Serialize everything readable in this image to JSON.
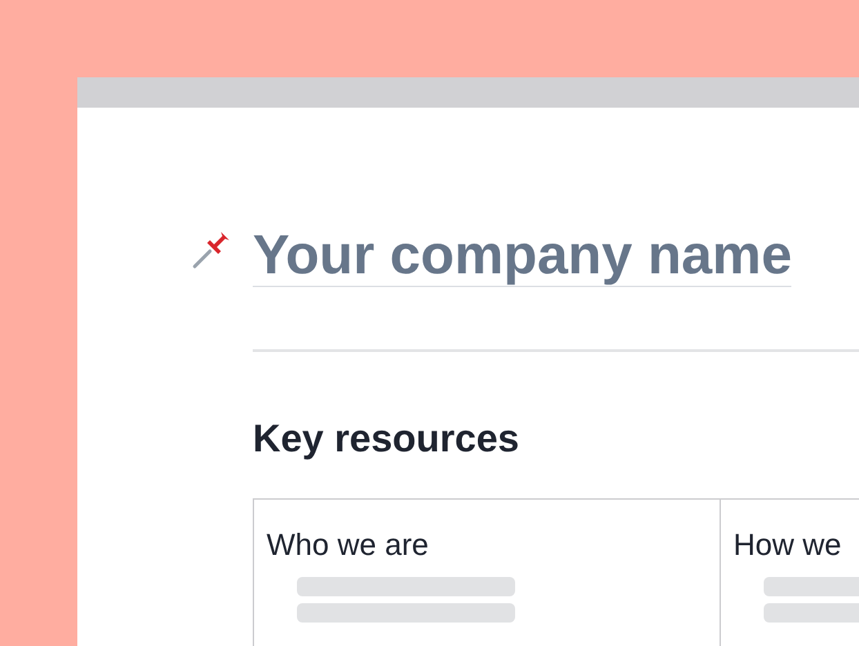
{
  "document": {
    "title": "Your company name",
    "heading": "Key resources",
    "table": {
      "columns": [
        {
          "label": "Who we are"
        },
        {
          "label": "How we"
        }
      ]
    }
  }
}
